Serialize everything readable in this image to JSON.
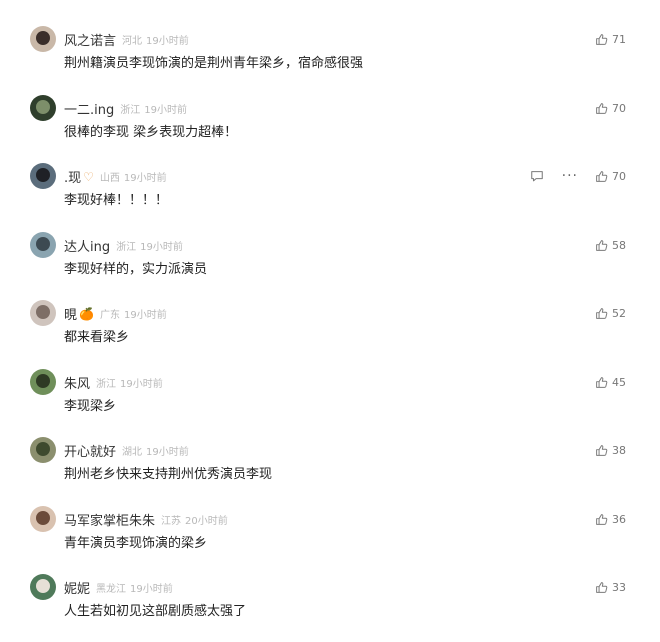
{
  "comments": [
    {
      "nick": "风之诺言",
      "badge": "",
      "location": "河北",
      "time": "19小时前",
      "text": "荆州籍演员李现饰演的是荆州青年梁乡，宿命感很强",
      "likes": "71",
      "avatar": [
        "#c9b8a8",
        "#3a2e2a"
      ]
    },
    {
      "nick": "一二.ing",
      "badge": "",
      "location": "浙江",
      "time": "19小时前",
      "text": "很棒的李现 梁乡表现力超棒！",
      "likes": "70",
      "avatar": [
        "#2f3f2c",
        "#7d8f6a"
      ]
    },
    {
      "nick": ".现",
      "badge": "♡",
      "location": "山西",
      "time": "19小时前",
      "text": "李现好棒！！！！",
      "likes": "70",
      "avatar": [
        "#5b6d7c",
        "#1f2126"
      ],
      "hover_tools": true
    },
    {
      "nick": "达人ing",
      "badge": "",
      "location": "浙江",
      "time": "19小时前",
      "text": "李现好样的，实力派演员",
      "likes": "58",
      "avatar": [
        "#8aa4b0",
        "#3d4a52"
      ]
    },
    {
      "nick": "晛",
      "badge": "🍊",
      "location": "广东",
      "time": "19小时前",
      "text": "都来看梁乡",
      "likes": "52",
      "avatar": [
        "#cfc4bd",
        "#7d6e66"
      ]
    },
    {
      "nick": "朱风",
      "badge": "",
      "location": "浙江",
      "time": "19小时前",
      "text": "李现梁乡",
      "likes": "45",
      "avatar": [
        "#6f8f5a",
        "#2e3a24"
      ]
    },
    {
      "nick": "开心就好",
      "badge": "",
      "location": "湖北",
      "time": "19小时前",
      "text": "荆州老乡快来支持荆州优秀演员李现",
      "likes": "38",
      "avatar": [
        "#8b8f6e",
        "#3e4a2e"
      ]
    },
    {
      "nick": "马军家掌柜朱朱",
      "badge": "",
      "location": "江苏",
      "time": "20小时前",
      "text": "青年演员李现饰演的梁乡",
      "likes": "36",
      "avatar": [
        "#d9c2b0",
        "#6b4b3a"
      ]
    },
    {
      "nick": "妮妮",
      "badge": "",
      "location": "黑龙江",
      "time": "19小时前",
      "text": "人生若如初见这部剧质感太强了",
      "likes": "33",
      "avatar": [
        "#4f7a5a",
        "#e6e0d6"
      ]
    }
  ],
  "icons": {
    "like": "thumbs-up-icon",
    "reply": "comment-icon",
    "more": "more-icon"
  },
  "colors": {
    "nick": "#333333",
    "text": "#222222",
    "meta": "#b8b8b8"
  }
}
